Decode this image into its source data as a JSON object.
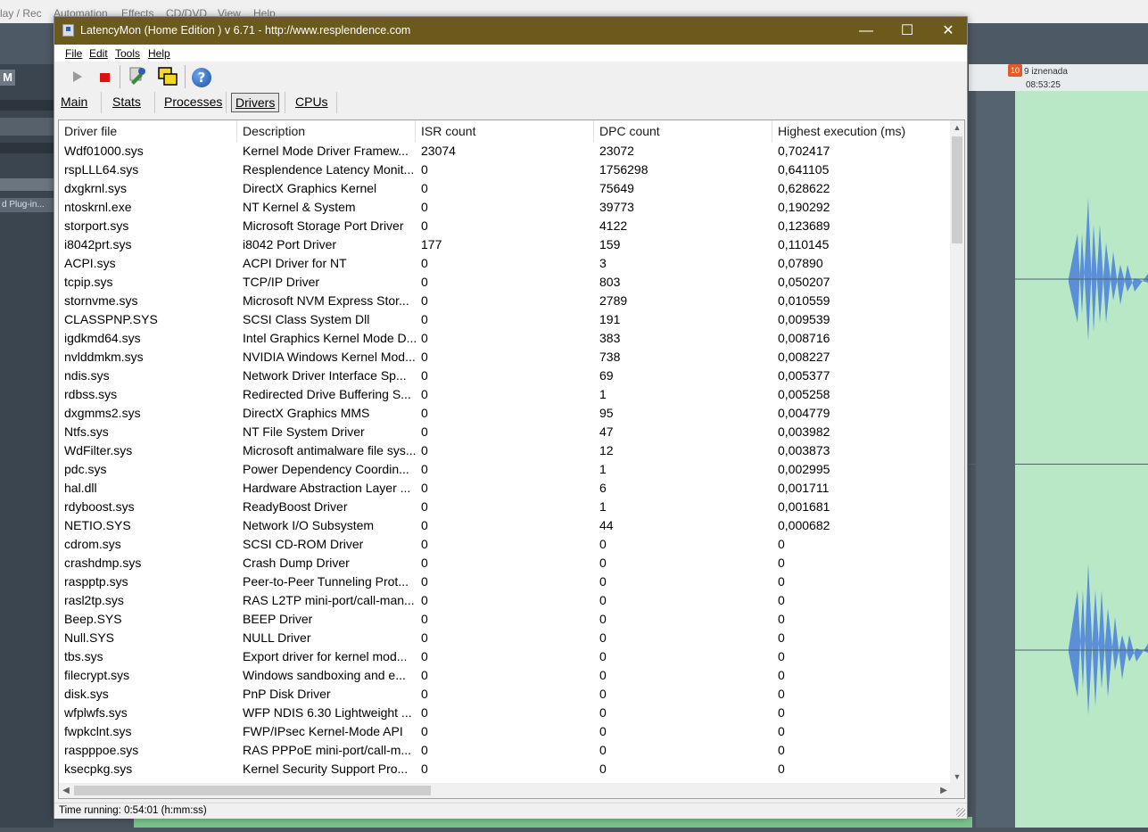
{
  "background": {
    "menu": [
      "lay / Rec",
      "Automation",
      "Effects",
      "CD/DVD",
      "View",
      "Help"
    ],
    "m_button": "M",
    "plugin_label": "d Plug-in...",
    "marker_number": "10",
    "marker_label": "9 iznenada",
    "time_readout": "08:53:25"
  },
  "window": {
    "title": "LatencyMon  (Home Edition )  v 6.71 - http://www.resplendence.com",
    "controls": {
      "minimize": "—",
      "maximize": "☐",
      "close": "✕"
    }
  },
  "menu": [
    "File",
    "Edit",
    "Tools",
    "Help"
  ],
  "toolbar": {
    "help": "?"
  },
  "tabs": [
    {
      "label": "Main",
      "active": false
    },
    {
      "label": "Stats",
      "active": false
    },
    {
      "label": "Processes",
      "active": false
    },
    {
      "label": "Drivers",
      "active": true
    },
    {
      "label": "CPUs",
      "active": false
    }
  ],
  "table": {
    "headers": [
      "Driver file",
      "Description",
      "ISR count",
      "DPC count",
      "Highest execution (ms)"
    ],
    "rows": [
      [
        "Wdf01000.sys",
        "Kernel Mode Driver Framew...",
        "23074",
        "23072",
        "0,702417"
      ],
      [
        "rspLLL64.sys",
        "Resplendence Latency Monit...",
        "0",
        "1756298",
        "0,641105"
      ],
      [
        "dxgkrnl.sys",
        "DirectX Graphics Kernel",
        "0",
        "75649",
        "0,628622"
      ],
      [
        "ntoskrnl.exe",
        "NT Kernel & System",
        "0",
        "39773",
        "0,190292"
      ],
      [
        "storport.sys",
        "Microsoft Storage Port Driver",
        "0",
        "4122",
        "0,123689"
      ],
      [
        "i8042prt.sys",
        "i8042 Port Driver",
        "177",
        "159",
        "0,110145"
      ],
      [
        "ACPI.sys",
        "ACPI Driver for NT",
        "0",
        "3",
        "0,07890"
      ],
      [
        "tcpip.sys",
        "TCP/IP Driver",
        "0",
        "803",
        "0,050207"
      ],
      [
        "stornvme.sys",
        "Microsoft NVM Express Stor...",
        "0",
        "2789",
        "0,010559"
      ],
      [
        "CLASSPNP.SYS",
        "SCSI Class System Dll",
        "0",
        "191",
        "0,009539"
      ],
      [
        "igdkmd64.sys",
        "Intel Graphics Kernel Mode D...",
        "0",
        "383",
        "0,008716"
      ],
      [
        "nvlddmkm.sys",
        "NVIDIA Windows Kernel Mod...",
        "0",
        "738",
        "0,008227"
      ],
      [
        "ndis.sys",
        "Network Driver Interface Sp...",
        "0",
        "69",
        "0,005377"
      ],
      [
        "rdbss.sys",
        "Redirected Drive Buffering S...",
        "0",
        "1",
        "0,005258"
      ],
      [
        "dxgmms2.sys",
        "DirectX Graphics MMS",
        "0",
        "95",
        "0,004779"
      ],
      [
        "Ntfs.sys",
        "NT File System Driver",
        "0",
        "47",
        "0,003982"
      ],
      [
        "WdFilter.sys",
        "Microsoft antimalware file sys...",
        "0",
        "12",
        "0,003873"
      ],
      [
        "pdc.sys",
        "Power Dependency Coordin...",
        "0",
        "1",
        "0,002995"
      ],
      [
        "hal.dll",
        "Hardware Abstraction Layer ...",
        "0",
        "6",
        "0,001711"
      ],
      [
        "rdyboost.sys",
        "ReadyBoost Driver",
        "0",
        "1",
        "0,001681"
      ],
      [
        "NETIO.SYS",
        "Network I/O Subsystem",
        "0",
        "44",
        "0,000682"
      ],
      [
        "cdrom.sys",
        "SCSI CD-ROM Driver",
        "0",
        "0",
        "0"
      ],
      [
        "crashdmp.sys",
        "Crash Dump Driver",
        "0",
        "0",
        "0"
      ],
      [
        "raspptp.sys",
        "Peer-to-Peer Tunneling Prot...",
        "0",
        "0",
        "0"
      ],
      [
        "rasl2tp.sys",
        "RAS L2TP mini-port/call-man...",
        "0",
        "0",
        "0"
      ],
      [
        "Beep.SYS",
        "BEEP Driver",
        "0",
        "0",
        "0"
      ],
      [
        "Null.SYS",
        "NULL Driver",
        "0",
        "0",
        "0"
      ],
      [
        "tbs.sys",
        "Export driver for kernel mod...",
        "0",
        "0",
        "0"
      ],
      [
        "filecrypt.sys",
        "Windows sandboxing and e...",
        "0",
        "0",
        "0"
      ],
      [
        "disk.sys",
        "PnP Disk Driver",
        "0",
        "0",
        "0"
      ],
      [
        "wfplwfs.sys",
        "WFP NDIS 6.30 Lightweight ...",
        "0",
        "0",
        "0"
      ],
      [
        "fwpkclnt.sys",
        "FWP/IPsec Kernel-Mode API",
        "0",
        "0",
        "0"
      ],
      [
        "raspppoe.sys",
        "RAS PPPoE mini-port/call-m...",
        "0",
        "0",
        "0"
      ],
      [
        "ksecpkg.sys",
        "Kernel Security Support Pro...",
        "0",
        "0",
        "0"
      ]
    ]
  },
  "status": {
    "text": "Time running: 0:54:01  (h:mm:ss)"
  },
  "colors": {
    "titlebar": "#6c5a1c",
    "stop": "#e01010",
    "help": "#1a4ea8",
    "wave": "#b8e8c6"
  }
}
